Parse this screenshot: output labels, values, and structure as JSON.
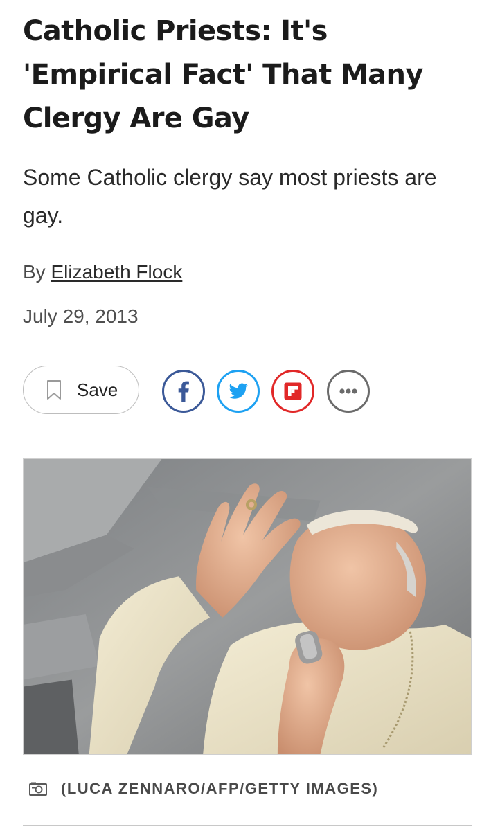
{
  "article": {
    "headline": "Catholic Priests: It's 'Empirical Fact' That Many Clergy Are Gay",
    "dek": "Some Catholic clergy say most priests are gay.",
    "byline_prefix": "By",
    "author": "Elizabeth Flock",
    "date": "July 29, 2013"
  },
  "actions": {
    "save_label": "Save",
    "share_icons": [
      "facebook-icon",
      "twitter-icon",
      "flipboard-icon",
      "more-icon"
    ]
  },
  "colors": {
    "facebook": "#3b5998",
    "twitter": "#1da1f2",
    "flipboard": "#e12828",
    "more": "#6b6b6b"
  },
  "photo": {
    "credit": "(LUCA ZENNARO/AFP/GETTY IMAGES)"
  }
}
